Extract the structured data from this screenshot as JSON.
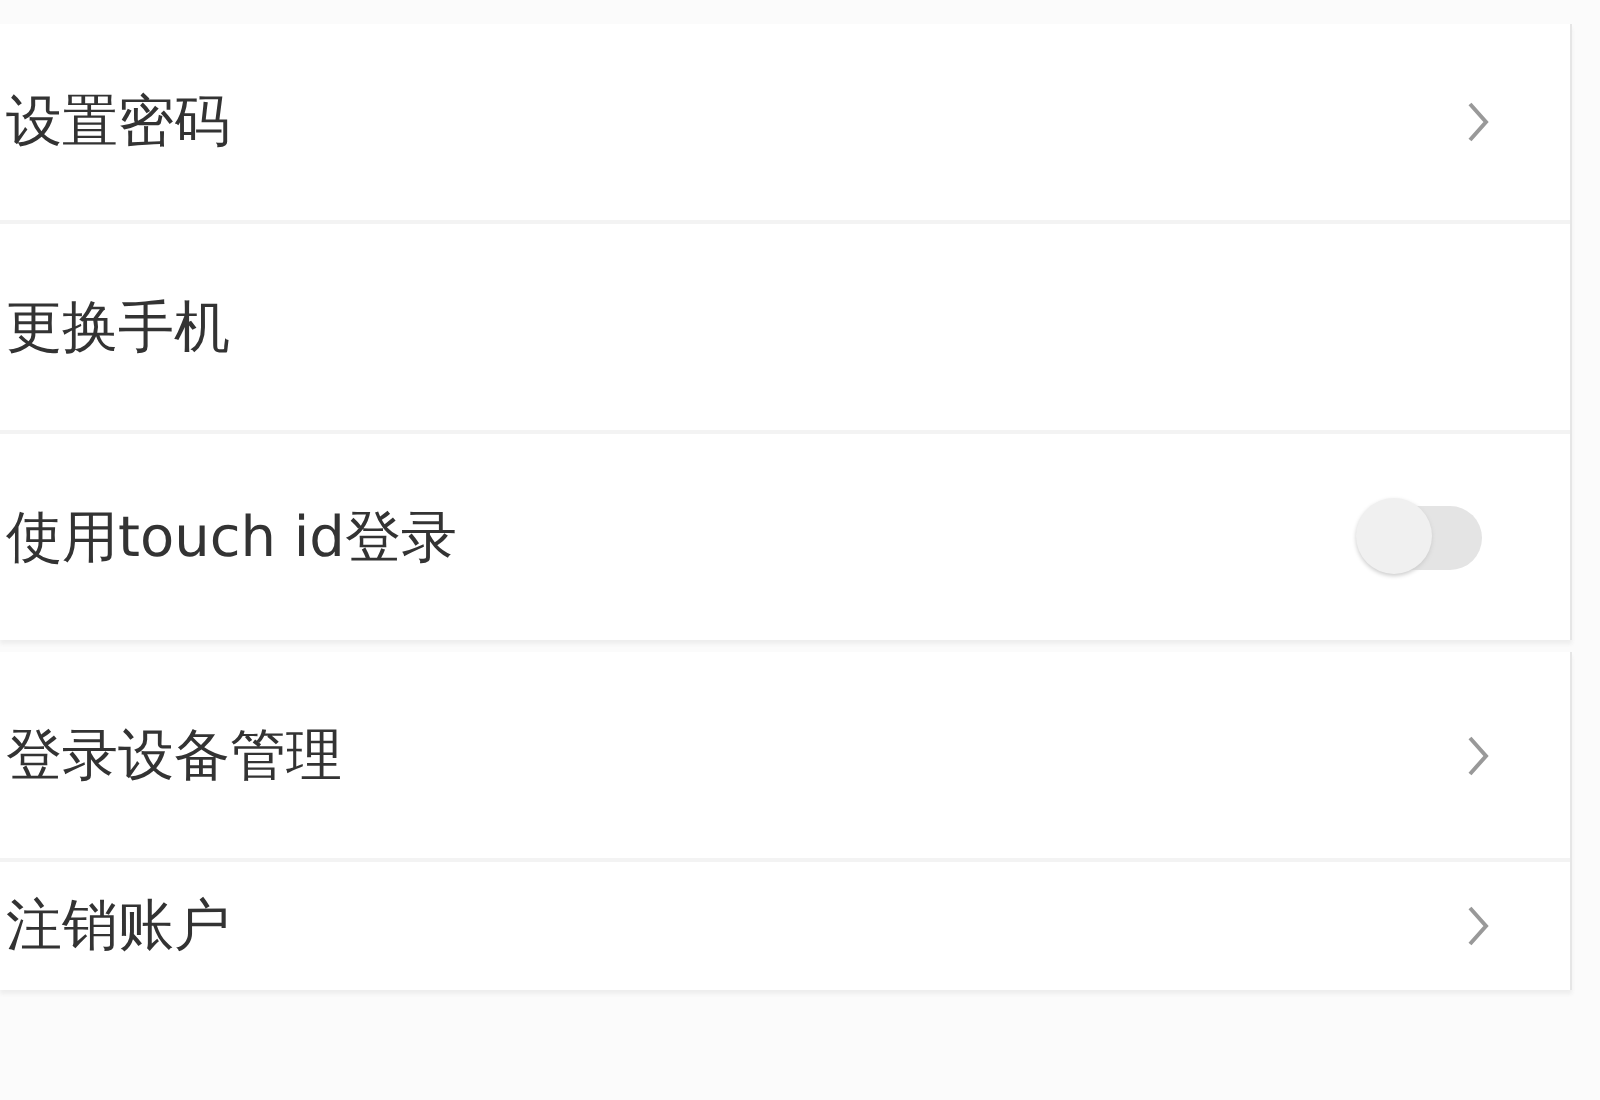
{
  "groups": [
    {
      "items": [
        {
          "kind": "link",
          "label": "设置密码"
        },
        {
          "kind": "plain",
          "label": "更换手机"
        },
        {
          "kind": "toggle",
          "label": "使用touch id登录",
          "on": false
        }
      ]
    },
    {
      "items": [
        {
          "kind": "link",
          "label": "登录设备管理"
        },
        {
          "kind": "link",
          "label": "注销账户"
        }
      ]
    }
  ]
}
